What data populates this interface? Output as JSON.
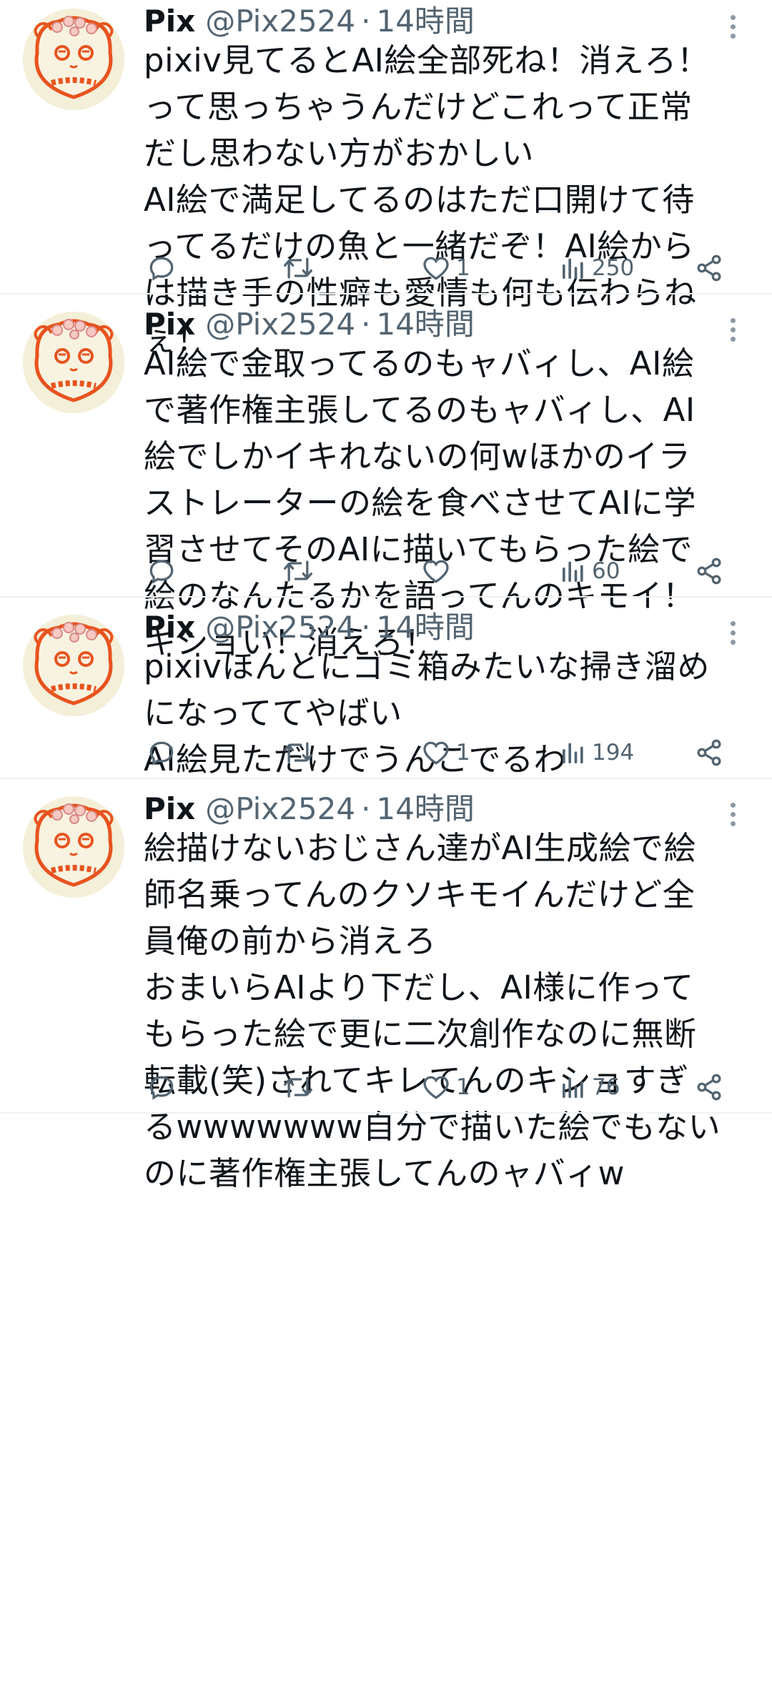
{
  "tweets": [
    {
      "name": "Pix",
      "handle": "@Pix2524",
      "separator": "·",
      "time": "14時間",
      "text": "pixiv見てるとAI絵全部死ね！消えろ！\nって思っちゃうんだけどこれって正常\nだし思わない方がおかしい\nAI絵で満足してるのはただ口開けて待\nってるだけの魚と一緒だぞ！AI絵から\nは描き手の性癖も愛情も何も伝わらね\nぇ！",
      "likes": "1",
      "views": "250"
    },
    {
      "name": "Pix",
      "handle": "@Pix2524",
      "separator": "·",
      "time": "14時間",
      "text": "AI絵で金取ってるのもャバィし、AI絵\nで著作権主張してるのもャバィし、AI\n絵でしかイキれないの何wほかのイラ\nストレーターの絵を食べさせてAIに学\n習させてそのAIに描いてもらった絵で\n絵のなんたるかを語ってんのキモイ！\nキショい！消えろ！",
      "likes": "",
      "views": "60"
    },
    {
      "name": "Pix",
      "handle": "@Pix2524",
      "separator": "·",
      "time": "14時間",
      "text": "pixivほんとにゴミ箱みたいな掃き溜め\nになっててやばい\nAI絵見ただけでうんこでるわ",
      "likes": "1",
      "views": "194"
    },
    {
      "name": "Pix",
      "handle": "@Pix2524",
      "separator": "·",
      "time": "14時間",
      "text": "絵描けないおじさん達がAI生成絵で絵\n師名乗ってんのクソキモイんだけど全\n員俺の前から消えろ\nおまいらAIより下だし、AI様に作って\nもらった絵で更に二次創作なのに無断\n転載(笑)されてキレてんのキショすぎ\nるwwwwwww自分で描いた絵でもない\nのに著作権主張してんのャバィw",
      "likes": "1",
      "views": "76"
    }
  ],
  "colors": {
    "text": "#0f1419",
    "secondary": "#536471",
    "divider": "#eff3f4",
    "avatar_line": "#e8531f",
    "avatar_bg": "#f4efd8"
  },
  "icons": [
    "reply-icon",
    "retweet-icon",
    "heart-icon",
    "views-icon",
    "share-icon",
    "more-icon"
  ]
}
